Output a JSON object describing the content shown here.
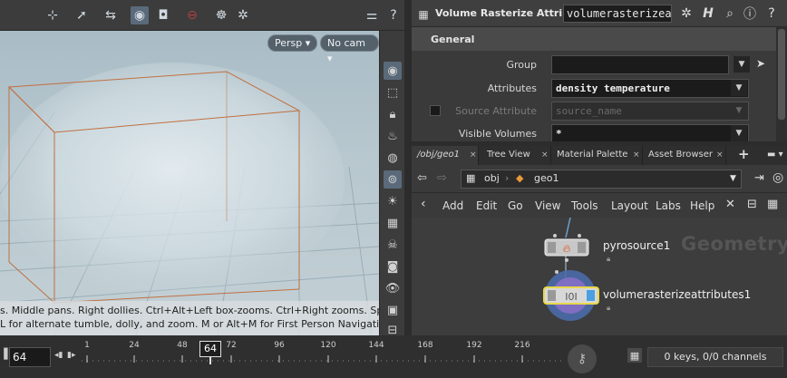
{
  "viewport": {
    "camera_label": "Persp",
    "cam_selector": "No cam",
    "help_line1": "s. Middle pans. Right dollies. Ctrl+Alt+Left box-zooms. Ctrl+Right zooms. Spacebar-",
    "help_line2": "L for alternate tumble, dolly, and zoom.     M or Alt+M for First Person Navigation."
  },
  "params": {
    "node_type": "Volume Rasterize Attrib...",
    "node_name": "volumerasterizeat",
    "folder": "General",
    "rows": [
      {
        "label": "Group",
        "value": "",
        "disabled": false
      },
      {
        "label": "Attributes",
        "value": "density temperature",
        "disabled": false
      },
      {
        "label": "Source Attribute",
        "value": "source_name",
        "disabled": true
      },
      {
        "label": "Visible Volumes",
        "value": "*",
        "disabled": false
      }
    ]
  },
  "network": {
    "tabs": [
      "/obj/geo1",
      "Tree View",
      "Material Palette",
      "Asset Browser"
    ],
    "path": [
      "obj",
      "geo1"
    ],
    "menu": [
      "Add",
      "Edit",
      "Go",
      "View",
      "Tools",
      "Layout",
      "Labs",
      "Help"
    ],
    "context_watermark": "Geometry",
    "nodes": [
      {
        "name": "pyrosource1"
      },
      {
        "name": "volumerasterizeattributes1"
      }
    ]
  },
  "timeline": {
    "current_frame": "64",
    "frame_field": "64",
    "ticks": [
      "1",
      "24",
      "48",
      "72",
      "96",
      "120",
      "144",
      "168",
      "192",
      "216"
    ],
    "keys_status": "0 keys, 0/0 channels"
  },
  "colors": {
    "accent_blue": "#5a6a7a",
    "selected_node": "#e8d84a",
    "bbox": "#c07040"
  }
}
